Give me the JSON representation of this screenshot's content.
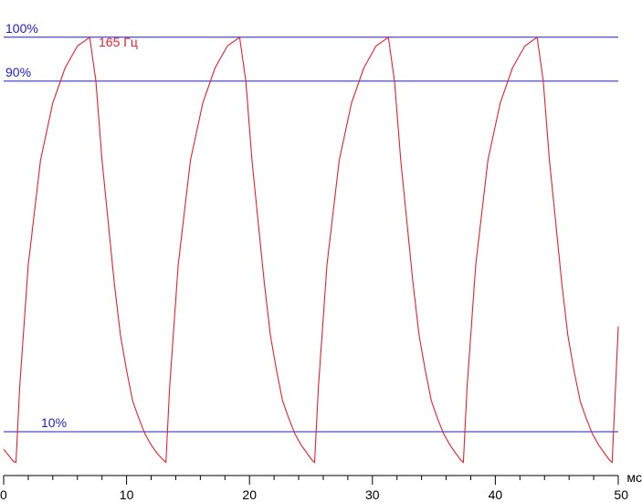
{
  "chart_data": {
    "type": "line",
    "title": "",
    "xlabel": "",
    "ylabel": "",
    "x_unit": "мс",
    "xlim": [
      0,
      50
    ],
    "ylim": [
      0,
      106
    ],
    "x_ticks": [
      {
        "value": 0,
        "label": "0"
      },
      {
        "value": 10,
        "label": "10"
      },
      {
        "value": 20,
        "label": "20"
      },
      {
        "value": 30,
        "label": "30"
      },
      {
        "value": 40,
        "label": "40"
      },
      {
        "value": 50,
        "label": "50"
      }
    ],
    "minor_tick_step": 2,
    "grid": false,
    "reference_lines": [
      {
        "value": 100,
        "label": "100%",
        "color": "#1c1cc8"
      },
      {
        "value": 90,
        "label": "90%",
        "color": "#1c1cc8"
      },
      {
        "value": 10,
        "label": "10%",
        "color": "#1c1cc8"
      }
    ],
    "series": [
      {
        "name": "165 Гц",
        "color": "#e8212b",
        "points": [
          [
            0.0,
            6.0
          ],
          [
            0.8,
            3.2
          ],
          [
            1.0,
            3.0
          ],
          [
            1.3,
            20.0
          ],
          [
            2.0,
            48.0
          ],
          [
            3.0,
            72.0
          ],
          [
            4.0,
            85.0
          ],
          [
            5.0,
            93.0
          ],
          [
            6.0,
            98.0
          ],
          [
            7.0,
            100.0
          ],
          [
            7.5,
            90.0
          ],
          [
            8.0,
            72.0
          ],
          [
            8.5,
            58.0
          ],
          [
            9.0,
            44.0
          ],
          [
            9.5,
            32.0
          ],
          [
            10.0,
            24.0
          ],
          [
            10.5,
            17.0
          ],
          [
            11.0,
            13.0
          ],
          [
            11.5,
            9.5
          ],
          [
            12.0,
            7.0
          ],
          [
            12.5,
            5.0
          ],
          [
            13.0,
            3.5
          ],
          [
            13.2,
            3.0
          ],
          [
            13.5,
            20.0
          ],
          [
            14.2,
            48.0
          ],
          [
            15.2,
            72.0
          ],
          [
            16.2,
            85.0
          ],
          [
            17.2,
            93.0
          ],
          [
            18.2,
            98.0
          ],
          [
            19.2,
            100.0
          ],
          [
            19.7,
            90.0
          ],
          [
            20.2,
            72.0
          ],
          [
            20.7,
            58.0
          ],
          [
            21.2,
            44.0
          ],
          [
            21.7,
            32.0
          ],
          [
            22.2,
            24.0
          ],
          [
            22.7,
            17.0
          ],
          [
            23.2,
            13.0
          ],
          [
            23.7,
            9.5
          ],
          [
            24.2,
            7.0
          ],
          [
            24.7,
            5.0
          ],
          [
            25.1,
            3.5
          ],
          [
            25.3,
            3.0
          ],
          [
            25.6,
            20.0
          ],
          [
            26.3,
            48.0
          ],
          [
            27.3,
            72.0
          ],
          [
            28.3,
            85.0
          ],
          [
            29.3,
            93.0
          ],
          [
            30.3,
            98.0
          ],
          [
            31.3,
            100.0
          ],
          [
            31.8,
            90.0
          ],
          [
            32.3,
            72.0
          ],
          [
            32.8,
            58.0
          ],
          [
            33.3,
            44.0
          ],
          [
            33.8,
            32.0
          ],
          [
            34.3,
            24.0
          ],
          [
            34.8,
            17.0
          ],
          [
            35.3,
            13.0
          ],
          [
            35.8,
            9.5
          ],
          [
            36.3,
            7.0
          ],
          [
            36.8,
            5.0
          ],
          [
            37.2,
            3.5
          ],
          [
            37.4,
            3.0
          ],
          [
            37.7,
            20.0
          ],
          [
            38.4,
            48.0
          ],
          [
            39.4,
            72.0
          ],
          [
            40.4,
            85.0
          ],
          [
            41.4,
            93.0
          ],
          [
            42.4,
            98.0
          ],
          [
            43.4,
            100.0
          ],
          [
            43.9,
            90.0
          ],
          [
            44.4,
            72.0
          ],
          [
            44.9,
            58.0
          ],
          [
            45.4,
            44.0
          ],
          [
            45.9,
            32.0
          ],
          [
            46.4,
            24.0
          ],
          [
            46.9,
            17.0
          ],
          [
            47.4,
            13.0
          ],
          [
            47.9,
            9.5
          ],
          [
            48.4,
            7.0
          ],
          [
            48.9,
            5.0
          ],
          [
            49.3,
            3.5
          ],
          [
            49.5,
            3.0
          ],
          [
            50.0,
            34.0
          ]
        ]
      }
    ]
  }
}
